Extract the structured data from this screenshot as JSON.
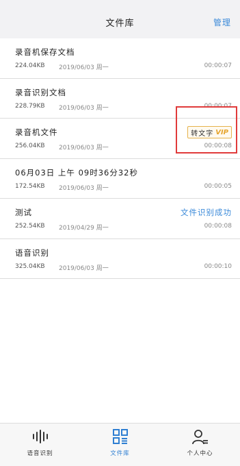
{
  "header": {
    "title": "文件库",
    "action": "管理"
  },
  "files": [
    {
      "name": "录音机保存文档",
      "size": "224.04KB",
      "date": "2019/06/03 周一",
      "duration": "00:00:07"
    },
    {
      "name": "录音识别文档",
      "size": "228.79KB",
      "date": "2019/06/03 周一",
      "duration": "00:00:07"
    },
    {
      "name": "录音机文件",
      "size": "256.04KB",
      "date": "2019/06/03 周一",
      "duration": "00:00:08",
      "badge": {
        "text": "转文字",
        "vip": "VIP"
      }
    },
    {
      "name": "06月03日 上午 09时36分32秒",
      "size": "172.54KB",
      "date": "2019/06/03 周一",
      "duration": "00:00:05"
    },
    {
      "name": "测试",
      "size": "252.54KB",
      "date": "2019/04/29 周一",
      "duration": "00:00:08",
      "status": "文件识别成功"
    },
    {
      "name": "语音识别",
      "size": "325.04KB",
      "date": "2019/06/03 周一",
      "duration": "00:00:10"
    }
  ],
  "tabs": [
    {
      "label": "语音识别",
      "icon": "waveform-icon"
    },
    {
      "label": "文件库",
      "icon": "grid-list-icon",
      "active": true
    },
    {
      "label": "个人中心",
      "icon": "user-profile-icon"
    }
  ],
  "colors": {
    "accent": "#3b8ad9",
    "vip": "#e6a52e",
    "highlight": "#e03a3a"
  }
}
